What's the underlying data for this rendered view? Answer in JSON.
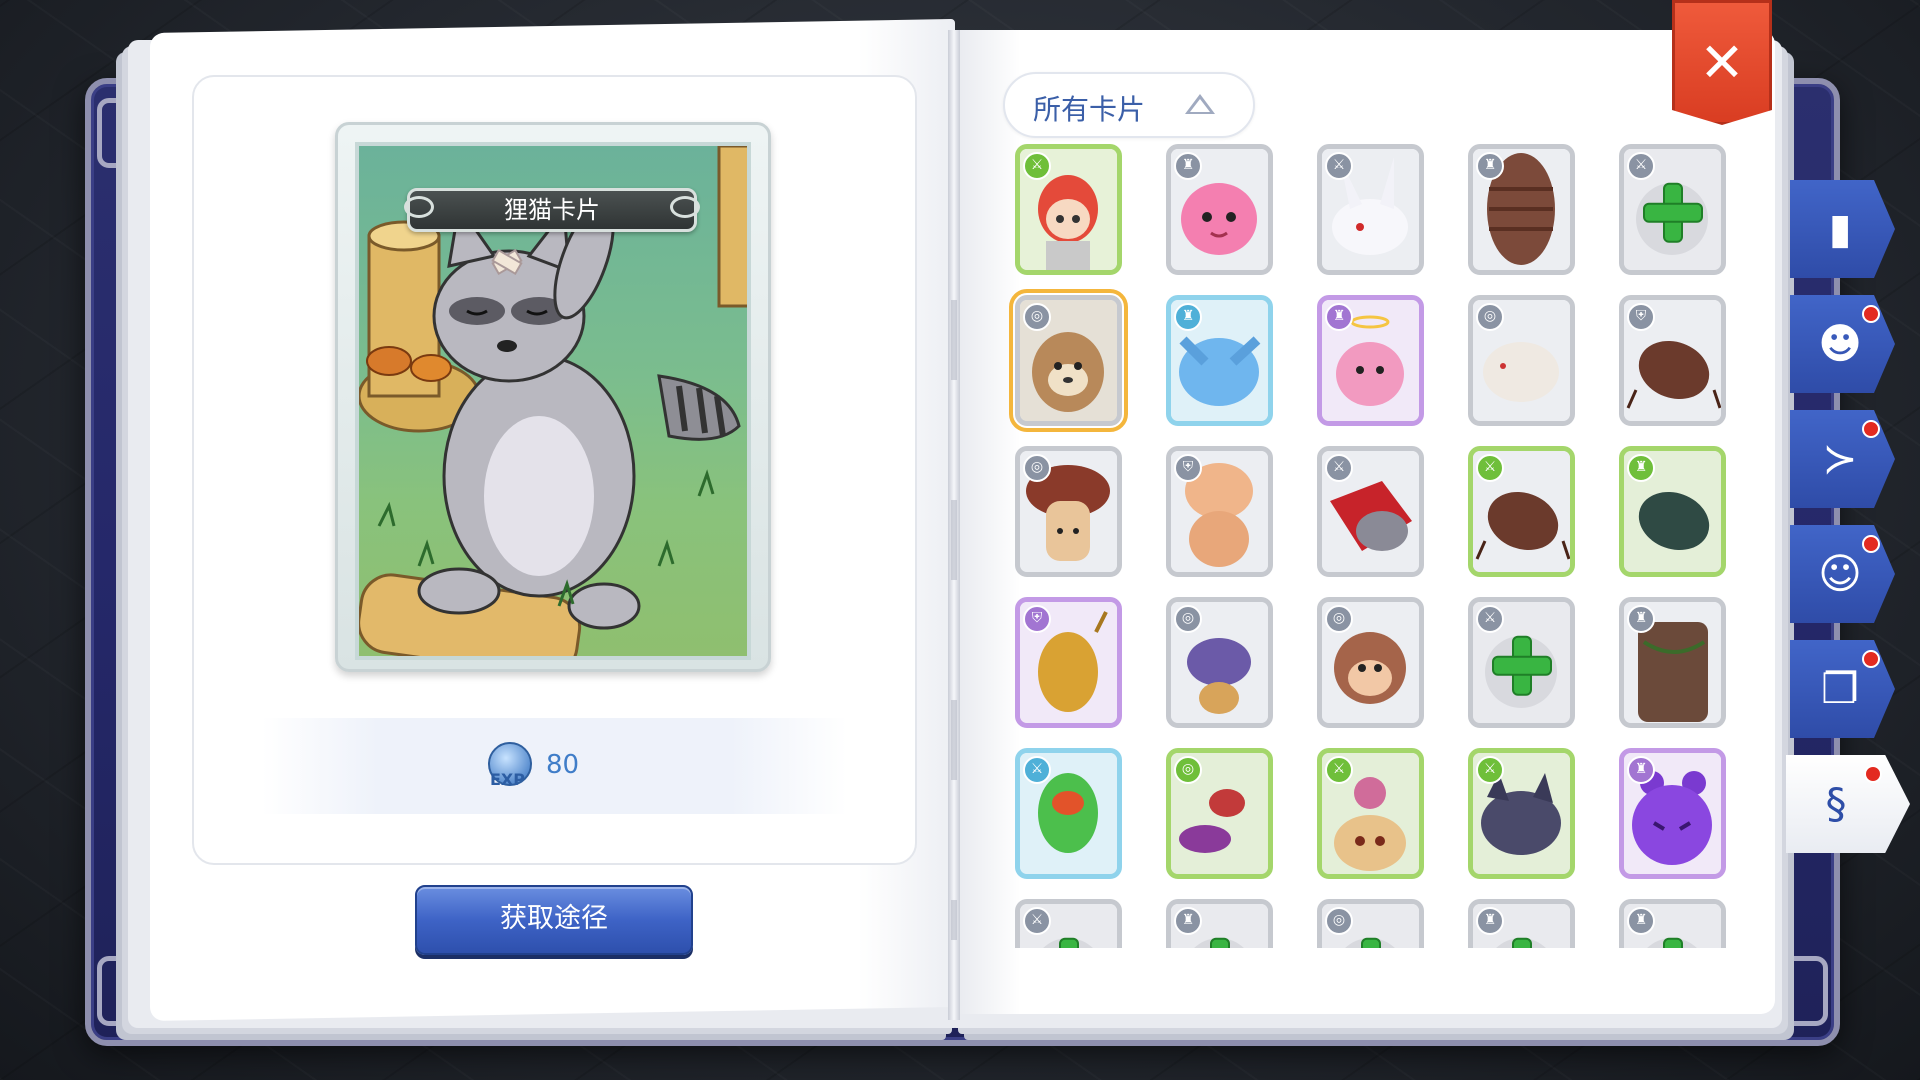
{
  "card_detail": {
    "name": "狸猫卡片",
    "exp_value": "80",
    "exp_icon_label": "EXP",
    "acquire_button": "获取途径"
  },
  "filter": {
    "label": "所有卡片"
  },
  "close_label": "✕",
  "colors": {
    "book_cover": "#2b2f6e",
    "accent_blue": "#3e63c6",
    "close_red": "#e34a2e",
    "plus_green": "#39b542",
    "selected_gold": "#f4b63c"
  },
  "cards": [
    {
      "name": "red-haired-boy",
      "rarity": "green",
      "art": "boy",
      "badge": "sword"
    },
    {
      "name": "pink-poring",
      "rarity": "gray",
      "art": "poring",
      "badge": "armor"
    },
    {
      "name": "white-lunatic",
      "rarity": "gray",
      "art": "lunatic",
      "badge": "sword"
    },
    {
      "name": "brown-cocoon",
      "rarity": "gray",
      "art": "cocoon",
      "badge": "armor"
    },
    {
      "name": "empty-slot",
      "rarity": "gray",
      "art": "plus",
      "badge": "sword"
    },
    {
      "name": "raccoon",
      "rarity": "gray",
      "art": "raccoon",
      "badge": "ring",
      "selected": true
    },
    {
      "name": "blue-spore",
      "rarity": "blue",
      "art": "bluefur",
      "badge": "armor"
    },
    {
      "name": "angel-poring",
      "rarity": "purple",
      "art": "angeling",
      "badge": "armor"
    },
    {
      "name": "white-rat",
      "rarity": "gray",
      "art": "rat",
      "badge": "ring"
    },
    {
      "name": "brown-beetle",
      "rarity": "gray",
      "art": "beetle",
      "badge": "shield"
    },
    {
      "name": "mushroom",
      "rarity": "gray",
      "art": "mushroom",
      "badge": "ring"
    },
    {
      "name": "peanut-pupa",
      "rarity": "gray",
      "art": "pupa",
      "badge": "shield"
    },
    {
      "name": "red-knight",
      "rarity": "gray",
      "art": "knight",
      "badge": "sword"
    },
    {
      "name": "horn-beetle",
      "rarity": "green",
      "art": "beetle",
      "badge": "sword"
    },
    {
      "name": "green-beetle",
      "rarity": "green",
      "art": "greenbeetle",
      "badge": "armor"
    },
    {
      "name": "golden-bug",
      "rarity": "purple",
      "art": "goldbug",
      "badge": "shield"
    },
    {
      "name": "purple-wasp",
      "rarity": "gray",
      "art": "wasp",
      "badge": "ring"
    },
    {
      "name": "monkey",
      "rarity": "gray",
      "art": "monkey",
      "badge": "ring"
    },
    {
      "name": "empty-slot-2",
      "rarity": "gray",
      "art": "plus",
      "badge": "sword"
    },
    {
      "name": "tree-stump",
      "rarity": "gray",
      "art": "stump",
      "badge": "armor"
    },
    {
      "name": "green-plant",
      "rarity": "blue",
      "art": "plant",
      "badge": "sword"
    },
    {
      "name": "mosquito",
      "rarity": "green",
      "art": "mosquito",
      "badge": "ring"
    },
    {
      "name": "flower-monster",
      "rarity": "green",
      "art": "flower",
      "badge": "sword"
    },
    {
      "name": "wolf",
      "rarity": "green",
      "art": "wolf",
      "badge": "sword"
    },
    {
      "name": "purple-ghost",
      "rarity": "purple",
      "art": "ghost",
      "badge": "armor"
    },
    {
      "name": "empty-slot-3",
      "rarity": "gray",
      "art": "plus",
      "badge": "sword"
    },
    {
      "name": "empty-slot-4",
      "rarity": "gray",
      "art": "plus",
      "badge": "armor"
    },
    {
      "name": "empty-slot-5",
      "rarity": "gray",
      "art": "plus",
      "badge": "ring"
    },
    {
      "name": "empty-slot-6",
      "rarity": "gray",
      "art": "plus",
      "badge": "armor"
    },
    {
      "name": "empty-slot-7",
      "rarity": "gray",
      "art": "plus",
      "badge": "armor"
    }
  ],
  "side_tabs": [
    {
      "name": "tab-book",
      "icon": "book-icon",
      "has_dot": false,
      "active": false
    },
    {
      "name": "tab-monster",
      "icon": "grin-cat-icon",
      "has_dot": true,
      "active": false
    },
    {
      "name": "tab-fish",
      "icon": "fish-icon",
      "has_dot": true,
      "active": false
    },
    {
      "name": "tab-head",
      "icon": "head-icon",
      "has_dot": true,
      "active": false
    },
    {
      "name": "tab-map",
      "icon": "open-book-icon",
      "has_dot": true,
      "active": false
    },
    {
      "name": "tab-card",
      "icon": "card-icon",
      "has_dot": true,
      "active": true
    }
  ]
}
